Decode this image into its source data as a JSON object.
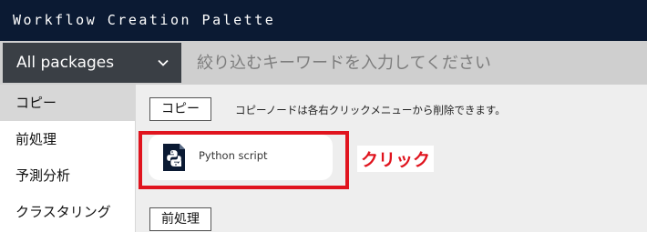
{
  "title": "Workflow Creation Palette",
  "toolbar": {
    "package_select": "All packages",
    "search_placeholder": "絞り込むキーワードを入力してください"
  },
  "sidebar": {
    "items": [
      {
        "label": "コピー",
        "active": true
      },
      {
        "label": "前処理",
        "active": false
      },
      {
        "label": "予測分析",
        "active": false
      },
      {
        "label": "クラスタリング",
        "active": false
      }
    ]
  },
  "main": {
    "copy_category": "コピー",
    "copy_note": "コピーノードは各右クリックメニューから削除できます。",
    "node_card": {
      "label": "Python script",
      "icon": "python-icon"
    },
    "preprocess_category": "前処理"
  },
  "annotation": {
    "click_label": "クリック",
    "color": "#e0141e"
  }
}
